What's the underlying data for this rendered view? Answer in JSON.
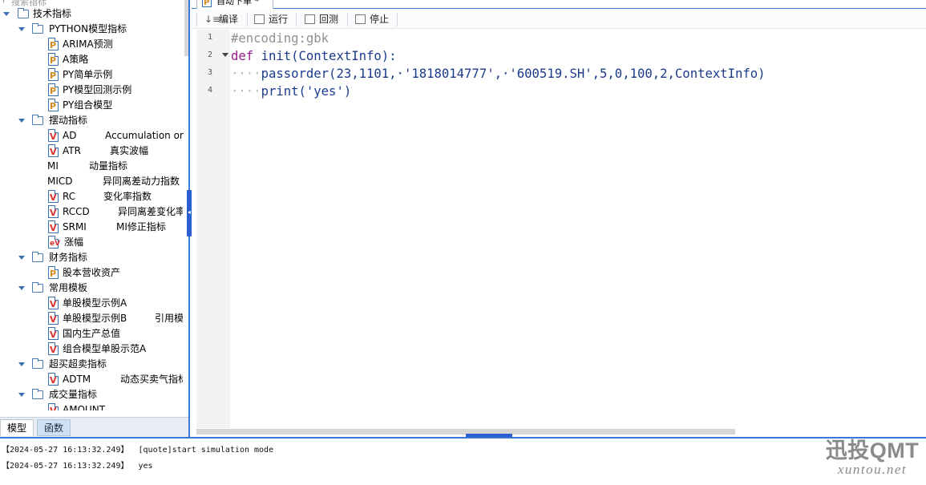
{
  "search": {
    "placeholder": "搜索指标"
  },
  "tree": {
    "root": "技术指标",
    "groups": [
      {
        "label": "PYTHON模型指标"
      },
      {
        "label": "摆动指标"
      },
      {
        "label": "财务指标"
      },
      {
        "label": "常用模板"
      },
      {
        "label": "超买超卖指标"
      },
      {
        "label": "成交量指标"
      }
    ],
    "items": [
      {
        "label": "ARIMA预测",
        "desc": "",
        "icon": "py-file-icon"
      },
      {
        "label": "A策略",
        "desc": "",
        "icon": "py-file-icon"
      },
      {
        "label": "PY简单示例",
        "desc": "",
        "icon": "py-file-icon"
      },
      {
        "label": "PY模型回测示例",
        "desc": "",
        "icon": "py-file-icon"
      },
      {
        "label": "PY组合模型",
        "desc": "",
        "icon": "py-file-icon"
      },
      {
        "label": "AD",
        "desc": "Accumulation or",
        "icon": "v-file-icon"
      },
      {
        "label": "ATR",
        "desc": "真实波幅",
        "icon": "v-file-icon"
      },
      {
        "label": "MI",
        "desc": "动量指标",
        "icon": "none"
      },
      {
        "label": "MICD",
        "desc": "异同离差动力指数",
        "icon": "none"
      },
      {
        "label": "RC",
        "desc": "变化率指数",
        "icon": "v-file-icon"
      },
      {
        "label": "RCCD",
        "desc": "异同离差变化率",
        "icon": "v-file-icon"
      },
      {
        "label": "SRMI",
        "desc": "MI修正指标",
        "icon": "v-file-icon"
      },
      {
        "label": "涨幅",
        "desc": "",
        "icon": "ev-file-icon"
      },
      {
        "label": "股本营收资产",
        "desc": "",
        "icon": "py-file-icon"
      },
      {
        "label": "单股模型示例A",
        "desc": "",
        "icon": "v-file-icon"
      },
      {
        "label": "单股模型示例B",
        "desc": "引用模",
        "icon": "v-file-icon"
      },
      {
        "label": "国内生产总值",
        "desc": "",
        "icon": "v-file-icon"
      },
      {
        "label": "组合模型单股示范A",
        "desc": "",
        "icon": "v-file-icon"
      },
      {
        "label": "ADTM",
        "desc": "动态买卖气指标",
        "icon": "v-file-icon"
      },
      {
        "label": "AMOUNT",
        "desc": "",
        "icon": "v-file-icon"
      }
    ]
  },
  "bottom_tabs": {
    "model": "模型",
    "function": "函数"
  },
  "file_tab": {
    "label": "自动下单 *"
  },
  "toolbar": {
    "compile": "编译",
    "run": "运行",
    "backtest": "回测",
    "stop": "停止"
  },
  "editor": {
    "line_numbers": [
      "1",
      "2",
      "3",
      "4"
    ],
    "line1": "#encoding:gbk",
    "line2": {
      "kw": "def",
      "fn": "init(ContextInfo):"
    },
    "line3": {
      "indent": "····",
      "code": "passorder(23,1101,·'1818014777',·'600519.SH',5,0,100,2,ContextInfo)"
    },
    "line4": {
      "indent": "····",
      "code": "print('yes')"
    }
  },
  "log": {
    "lines": [
      "【2024-05-27 16:13:32.249】  [quote]start simulation mode",
      "【2024-05-27 16:13:32.249】  yes"
    ]
  },
  "watermark": {
    "line1": "迅投QMT",
    "line2": "xuntou.net"
  }
}
